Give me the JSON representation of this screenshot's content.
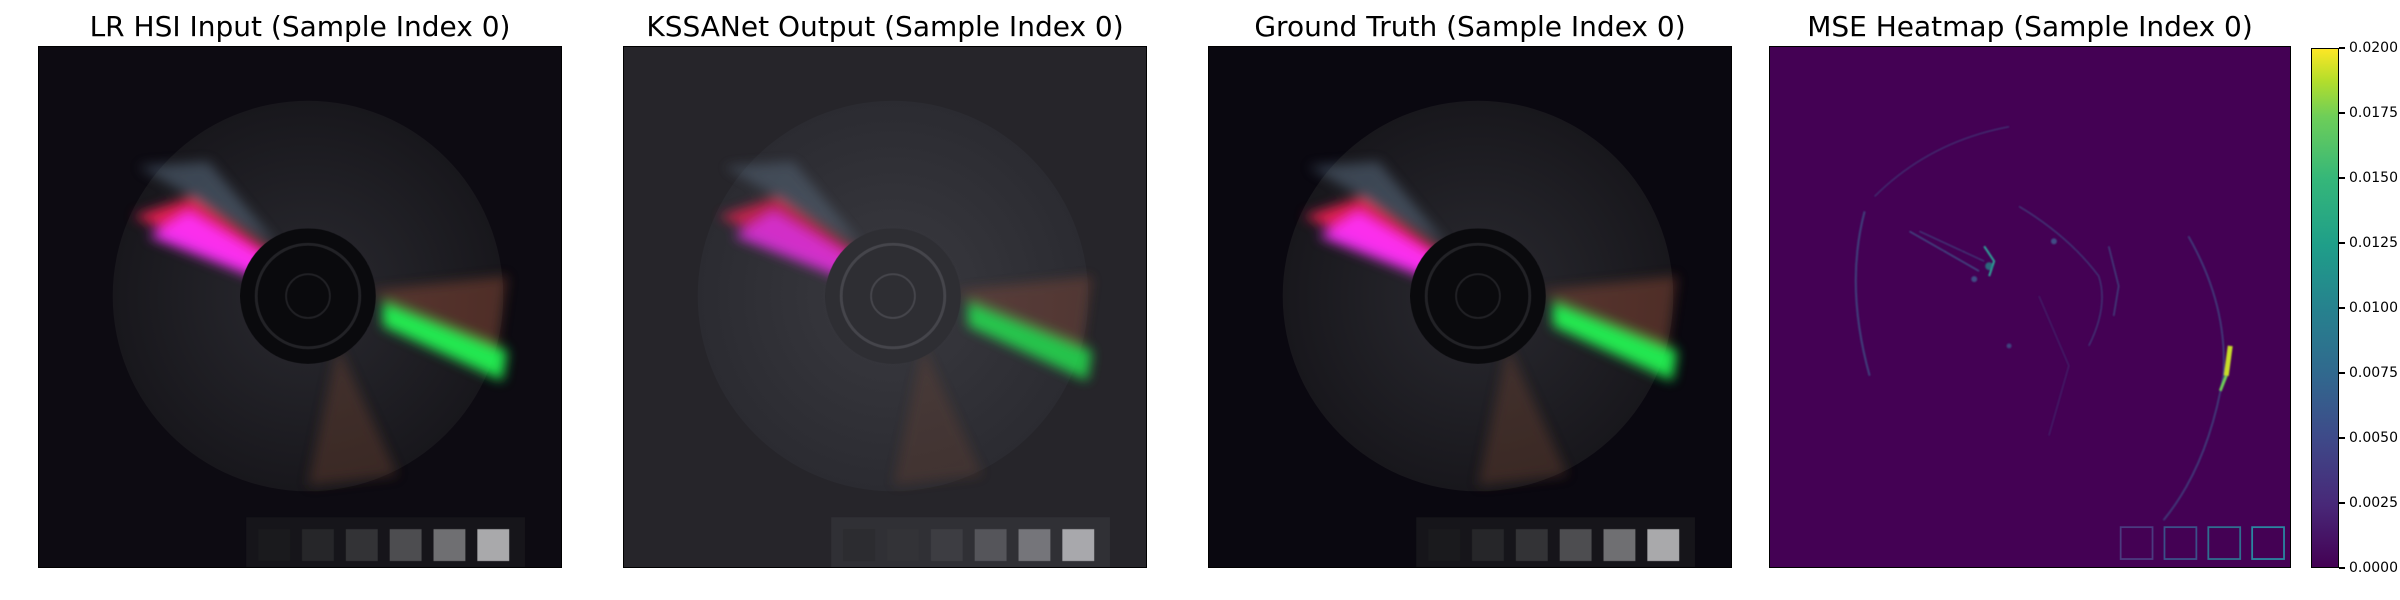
{
  "chart_data": [
    {
      "type": "image",
      "title": "LR HSI Input (Sample Index 0)",
      "variant": "input"
    },
    {
      "type": "image",
      "title": "KSSANet Output (Sample Index 0)",
      "variant": "output"
    },
    {
      "type": "image",
      "title": "Ground Truth (Sample Index 0)",
      "variant": "truth"
    },
    {
      "type": "heatmap",
      "title": "MSE Heatmap (Sample Index 0)",
      "colormap": "viridis",
      "clim": [
        0,
        0.02
      ],
      "colorbar_ticks": [
        "0.0000",
        "0.0025",
        "0.0050",
        "0.0075",
        "0.0100",
        "0.0125",
        "0.0150",
        "0.0175",
        "0.0200"
      ]
    }
  ],
  "colors": {
    "background_input": "#0d0b12",
    "background_output": "#26252a",
    "background_truth": "#0a0810",
    "heatmap_base": "#440154",
    "heatmap_edge": "#3e6e9a",
    "heatmap_hot": "#c8dd2a"
  }
}
